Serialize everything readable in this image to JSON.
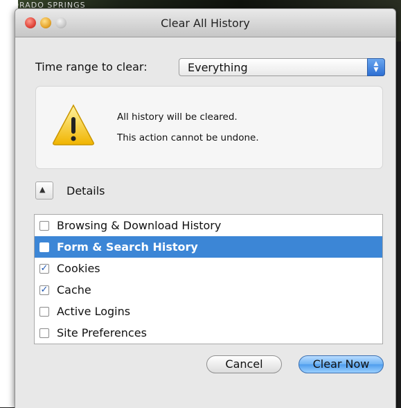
{
  "window": {
    "title": "Clear All History"
  },
  "background": {
    "banner_text": "OLORADO SPRINGS"
  },
  "time_range": {
    "label": "Time range to clear:",
    "selected": "Everything"
  },
  "warning": {
    "line1": "All history will be cleared.",
    "line2": "This action cannot be undone."
  },
  "details": {
    "label": "Details"
  },
  "items": [
    {
      "label": "Browsing & Download History",
      "checked": false,
      "selected": false
    },
    {
      "label": "Form & Search History",
      "checked": false,
      "selected": true
    },
    {
      "label": "Cookies",
      "checked": true,
      "selected": false
    },
    {
      "label": "Cache",
      "checked": true,
      "selected": false
    },
    {
      "label": "Active Logins",
      "checked": false,
      "selected": false
    },
    {
      "label": "Site Preferences",
      "checked": false,
      "selected": false
    }
  ],
  "buttons": {
    "cancel": "Cancel",
    "clear_now": "Clear Now"
  },
  "colors": {
    "selection": "#3c86d6",
    "default_button": "#6fb3f4",
    "warning_yellow": "#f5c518"
  },
  "icons": {
    "warning": "warning-triangle-icon",
    "disclosure": "triangle-up-icon",
    "popup_arrows": "updown-arrows-icon"
  }
}
